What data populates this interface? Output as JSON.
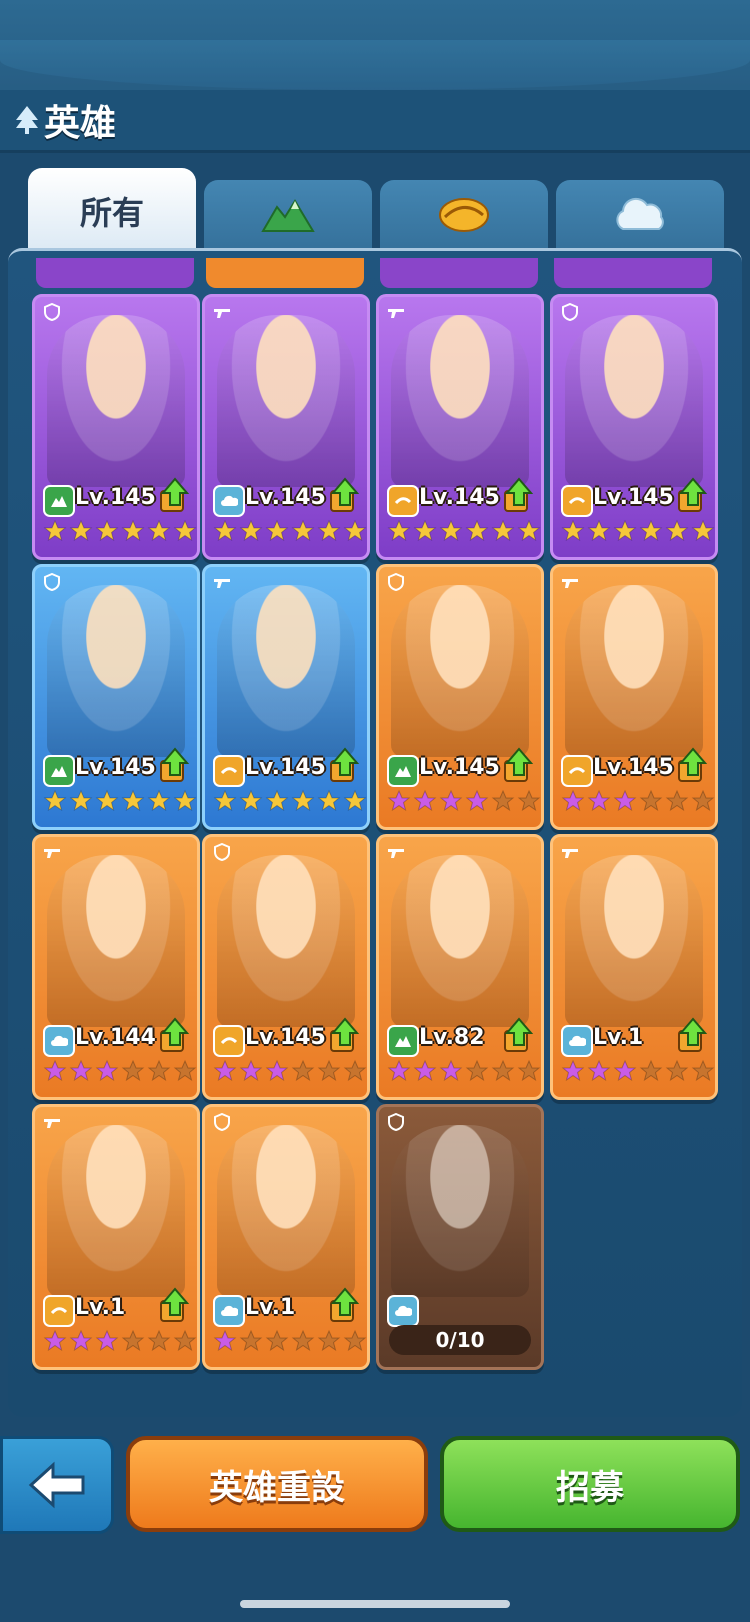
{
  "header": {
    "title": "英雄"
  },
  "tabs": [
    {
      "label": "所有",
      "icon": "all",
      "active": true
    },
    {
      "label": "",
      "icon": "mountain-icon",
      "active": false
    },
    {
      "label": "",
      "icon": "sand-icon",
      "active": false
    },
    {
      "label": "",
      "icon": "cloud-icon",
      "active": false
    }
  ],
  "heroes": [
    {
      "frame": "purple",
      "class": "shield",
      "element": "mountain",
      "level": "Lv.145",
      "stars": 6,
      "star_type": "gold",
      "upgrade": true
    },
    {
      "frame": "purple",
      "class": "gun",
      "element": "cloud",
      "level": "Lv.145",
      "stars": 6,
      "star_type": "gold",
      "upgrade": true
    },
    {
      "frame": "purple",
      "class": "gun",
      "element": "sand",
      "level": "Lv.145",
      "stars": 6,
      "star_type": "gold",
      "upgrade": true
    },
    {
      "frame": "purple",
      "class": "shield",
      "element": "sand",
      "level": "Lv.145",
      "stars": 6,
      "star_type": "gold",
      "upgrade": true
    },
    {
      "frame": "blue",
      "class": "shield",
      "element": "mountain",
      "level": "Lv.145",
      "stars": 6,
      "star_type": "gold",
      "upgrade": true
    },
    {
      "frame": "blue",
      "class": "gun",
      "element": "sand",
      "level": "Lv.145",
      "stars": 6,
      "star_type": "gold",
      "upgrade": true
    },
    {
      "frame": "orange",
      "class": "shield",
      "element": "mountain",
      "level": "Lv.145",
      "stars": 3.5,
      "star_type": "purple",
      "upgrade": true
    },
    {
      "frame": "orange",
      "class": "gun",
      "element": "sand",
      "level": "Lv.145",
      "stars": 3,
      "star_type": "purple",
      "upgrade": true
    },
    {
      "frame": "orange",
      "class": "gun",
      "element": "cloud",
      "level": "Lv.144",
      "stars": 3,
      "star_type": "purple",
      "upgrade": true
    },
    {
      "frame": "orange",
      "class": "shield",
      "element": "sand",
      "level": "Lv.145",
      "stars": 2.5,
      "star_type": "purple",
      "upgrade": true
    },
    {
      "frame": "orange",
      "class": "gun",
      "element": "mountain",
      "level": "Lv.82",
      "stars": 2.5,
      "star_type": "purple",
      "upgrade": true
    },
    {
      "frame": "orange",
      "class": "gun",
      "element": "cloud",
      "level": "Lv.1",
      "stars": 2.5,
      "star_type": "purple",
      "upgrade": true
    },
    {
      "frame": "orange",
      "class": "gun",
      "element": "sand",
      "level": "Lv.1",
      "stars": 2.5,
      "star_type": "purple",
      "upgrade": true
    },
    {
      "frame": "orange",
      "class": "shield",
      "element": "cloud",
      "level": "Lv.1",
      "stars": 1,
      "star_type": "purple",
      "upgrade": true
    },
    {
      "frame": "locked",
      "class": "shield",
      "element": "cloud",
      "level": "",
      "progress": "0/10",
      "stars": 0,
      "upgrade": false
    }
  ],
  "footer": {
    "back_label": "",
    "reset_label": "英雄重設",
    "recruit_label": "招募"
  },
  "colors": {
    "gold_star": "#f6c73a",
    "purple_star": "#c95ce6",
    "empty_star": "#c7742e"
  }
}
